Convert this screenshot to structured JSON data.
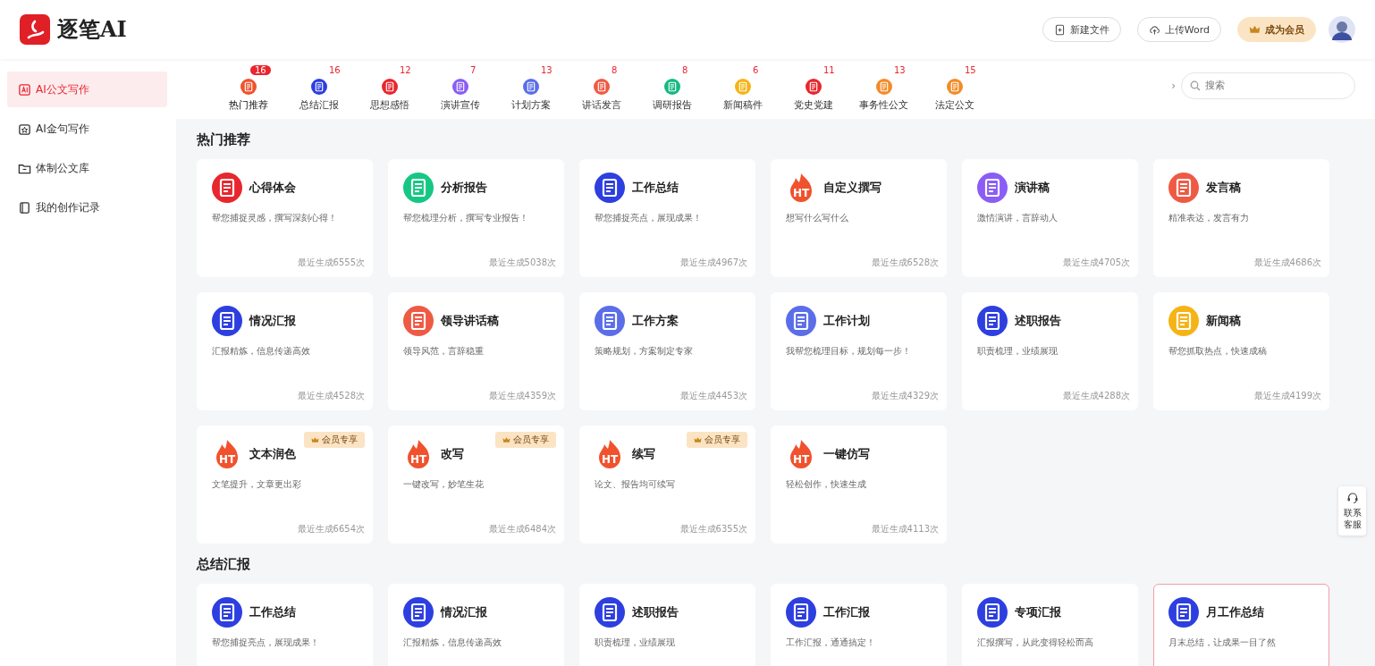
{
  "header": {
    "logo_text": "逐笔AI",
    "buttons": [
      {
        "kind": "new",
        "label": "新建文件"
      },
      {
        "kind": "upload",
        "label": "上传Word"
      },
      {
        "kind": "vip",
        "label": "成为会员"
      }
    ]
  },
  "sidebar": {
    "items": [
      {
        "label": "AI公文写作",
        "selected": true
      },
      {
        "label": "AI金句写作",
        "selected": false
      },
      {
        "label": "体制公文库",
        "selected": false
      },
      {
        "label": "我的创作记录",
        "selected": false
      }
    ]
  },
  "category_tabs": [
    {
      "label": "热门推荐",
      "count": "16",
      "selected": true,
      "color": "#f0522d"
    },
    {
      "label": "总结汇报",
      "count": "16",
      "selected": false,
      "color": "#2d3fe0"
    },
    {
      "label": "思想感悟",
      "count": "12",
      "selected": false,
      "color": "#e8262e"
    },
    {
      "label": "演讲宣传",
      "count": "7",
      "selected": false,
      "color": "#8b5cf6"
    },
    {
      "label": "计划方案",
      "count": "13",
      "selected": false,
      "color": "#5b6ee8"
    },
    {
      "label": "讲话发言",
      "count": "8",
      "selected": false,
      "color": "#ef5a45"
    },
    {
      "label": "调研报告",
      "count": "8",
      "selected": false,
      "color": "#16b981"
    },
    {
      "label": "新闻稿件",
      "count": "6",
      "selected": false,
      "color": "#f5b416"
    },
    {
      "label": "党史党建",
      "count": "11",
      "selected": false,
      "color": "#e8262e"
    },
    {
      "label": "事务性公文",
      "count": "13",
      "selected": false,
      "color": "#f28c28"
    },
    {
      "label": "法定公文",
      "count": "15",
      "selected": false,
      "color": "#f28c28"
    }
  ],
  "search": {
    "chevron": "›",
    "placeholder": "搜索"
  },
  "sections": [
    {
      "title": "热门推荐",
      "cards": [
        {
          "title": "心得体会",
          "desc": "帮您捕捉灵感，撰写深刻心得！",
          "count": "最近生成6555次",
          "selected": false,
          "icon": {
            "kind": "doc",
            "color": "#e8262e"
          }
        },
        {
          "title": "分析报告",
          "desc": "帮您梳理分析，撰写专业报告！",
          "count": "最近生成5038次",
          "selected": false,
          "icon": {
            "kind": "doc",
            "color": "#16c784"
          }
        },
        {
          "title": "工作总结",
          "desc": "帮您捕捉亮点，展现成果！",
          "count": "最近生成4967次",
          "selected": false,
          "icon": {
            "kind": "doc",
            "color": "#2d3fe0"
          }
        },
        {
          "title": "自定义撰写",
          "desc": "想写什么写什么",
          "count": "最近生成6528次",
          "selected": false,
          "icon": {
            "kind": "fire",
            "color": "#f0522d",
            "text": "HT"
          }
        },
        {
          "title": "演讲稿",
          "desc": "激情演讲，言辞动人",
          "count": "最近生成4705次",
          "selected": false,
          "icon": {
            "kind": "doc",
            "color": "#8b5cf6"
          }
        },
        {
          "title": "发言稿",
          "desc": "精准表达，发言有力",
          "count": "最近生成4686次",
          "selected": false,
          "icon": {
            "kind": "doc",
            "color": "#ef5a45"
          }
        },
        {
          "title": "情况汇报",
          "desc": "汇报精炼，信息传递高效",
          "count": "最近生成4528次",
          "selected": false,
          "icon": {
            "kind": "doc",
            "color": "#2d3fe0"
          }
        },
        {
          "title": "领导讲话稿",
          "desc": "领导风范，言辞稳重",
          "count": "最近生成4359次",
          "selected": false,
          "icon": {
            "kind": "doc",
            "color": "#ef5a45"
          }
        },
        {
          "title": "工作方案",
          "desc": "策略规划，方案制定专家",
          "count": "最近生成4453次",
          "selected": false,
          "icon": {
            "kind": "doc",
            "color": "#5b6ee8"
          }
        },
        {
          "title": "工作计划",
          "desc": "我帮您梳理目标，规划每一步！",
          "count": "最近生成4329次",
          "selected": false,
          "icon": {
            "kind": "doc",
            "color": "#5b6ee8"
          }
        },
        {
          "title": "述职报告",
          "desc": "职责梳理，业绩展现",
          "count": "最近生成4288次",
          "selected": false,
          "icon": {
            "kind": "doc",
            "color": "#2d3fe0"
          }
        },
        {
          "title": "新闻稿",
          "desc": "帮您抓取热点，快速成稿",
          "count": "最近生成4199次",
          "selected": false,
          "icon": {
            "kind": "doc",
            "color": "#f5b416"
          }
        },
        {
          "title": "文本润色",
          "desc": "文笔提升，文章更出彩",
          "count": "最近生成6654次",
          "selected": false,
          "vip_tag": "会员专享",
          "icon": {
            "kind": "fire",
            "color": "#f0522d",
            "text": "HT"
          }
        },
        {
          "title": "改写",
          "desc": "一键改写，妙笔生花",
          "count": "最近生成6484次",
          "selected": false,
          "vip_tag": "会员专享",
          "icon": {
            "kind": "fire",
            "color": "#f0522d",
            "text": "HT"
          }
        },
        {
          "title": "续写",
          "desc": "论文、报告均可续写",
          "count": "最近生成6355次",
          "selected": false,
          "vip_tag": "会员专享",
          "icon": {
            "kind": "fire",
            "color": "#f0522d",
            "text": "HT"
          }
        },
        {
          "title": "一键仿写",
          "desc": "轻松创作，快速生成",
          "count": "最近生成4113次",
          "selected": false,
          "icon": {
            "kind": "fire",
            "color": "#f0522d",
            "text": "HT"
          }
        }
      ]
    },
    {
      "title": "总结汇报",
      "cards": [
        {
          "title": "工作总结",
          "desc": "帮您捕捉亮点，展现成果！",
          "selected": false,
          "icon": {
            "kind": "doc",
            "color": "#2d3fe0"
          }
        },
        {
          "title": "情况汇报",
          "desc": "汇报精炼，信息传递高效",
          "selected": false,
          "icon": {
            "kind": "doc",
            "color": "#2d3fe0"
          }
        },
        {
          "title": "述职报告",
          "desc": "职责梳理，业绩展现",
          "selected": false,
          "icon": {
            "kind": "doc",
            "color": "#2d3fe0"
          }
        },
        {
          "title": "工作汇报",
          "desc": "工作汇报，通通搞定！",
          "selected": false,
          "icon": {
            "kind": "doc",
            "color": "#2d3fe0"
          }
        },
        {
          "title": "专项汇报",
          "desc": "汇报撰写，从此变得轻松而高",
          "selected": false,
          "icon": {
            "kind": "doc",
            "color": "#2d3fe0"
          }
        },
        {
          "title": "月工作总结",
          "desc": "月末总结，让成果一目了然",
          "selected": true,
          "icon": {
            "kind": "doc",
            "color": "#2d3fe0"
          }
        }
      ]
    }
  ],
  "support": {
    "label": "联系客服"
  }
}
